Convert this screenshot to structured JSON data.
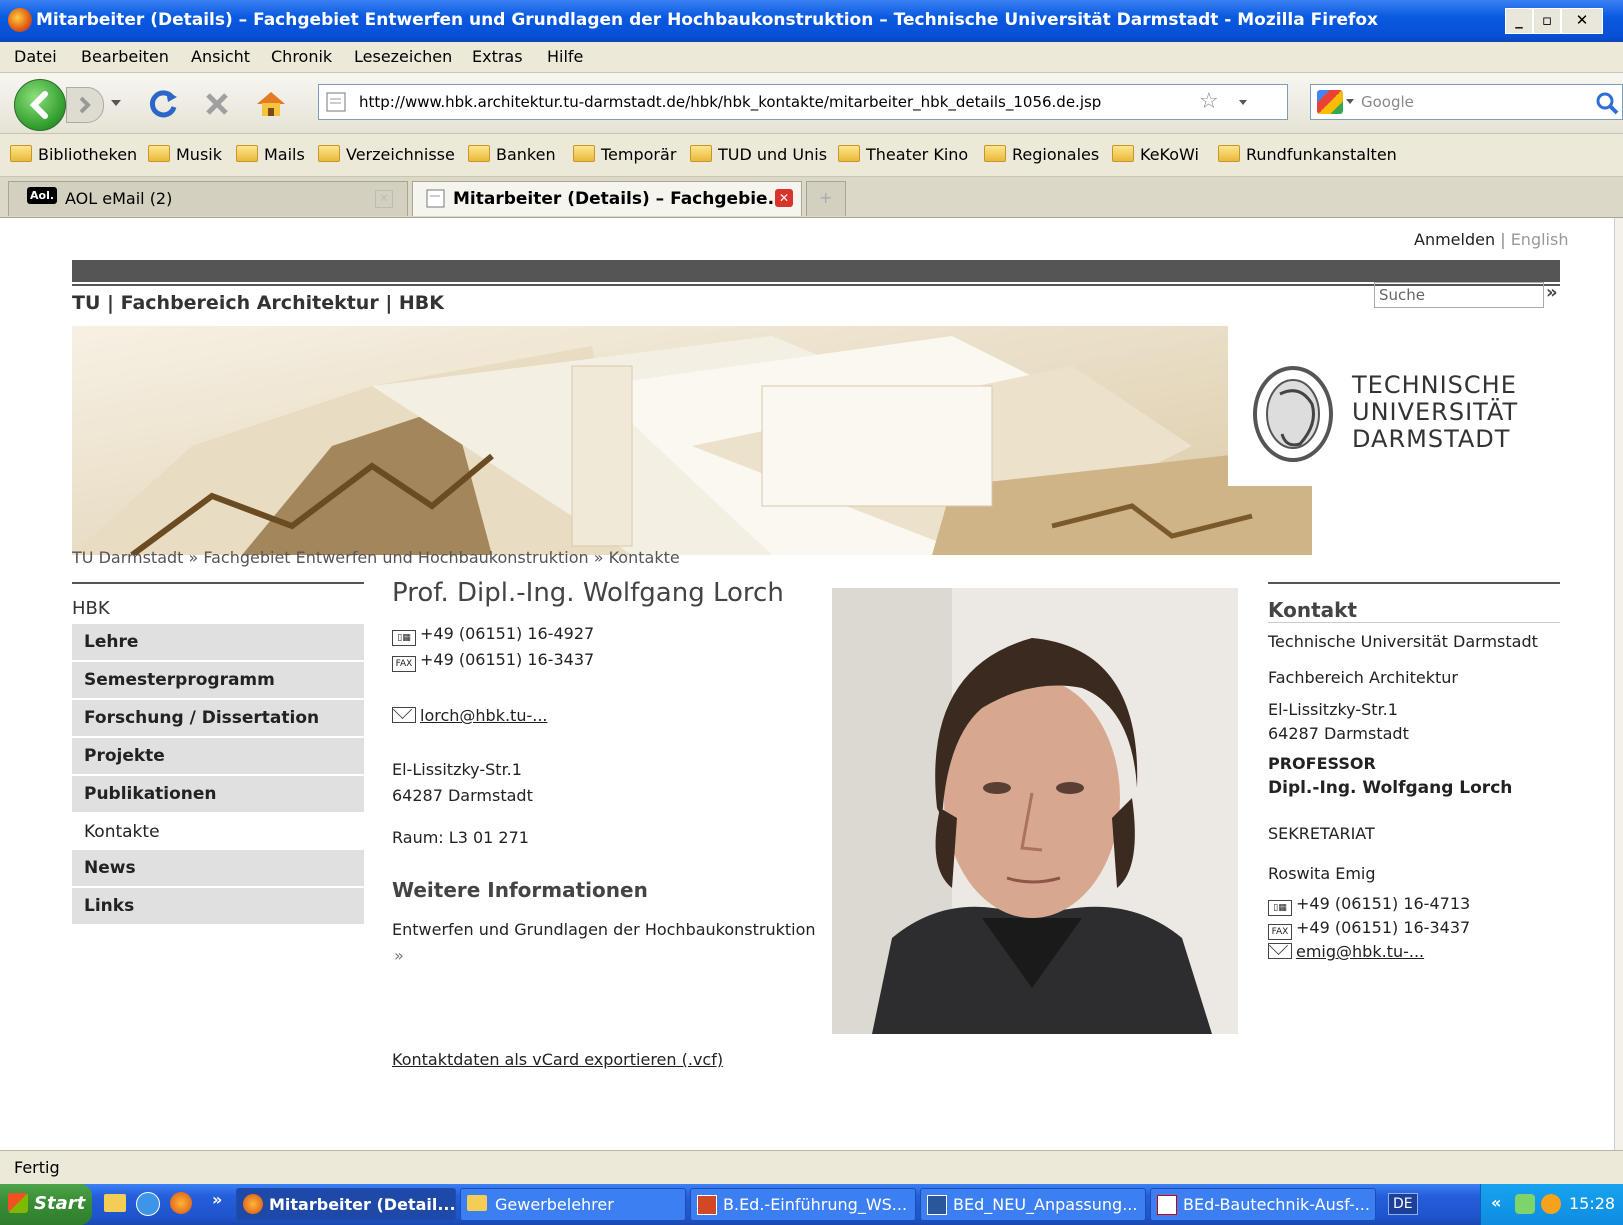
{
  "window": {
    "title": "Mitarbeiter (Details) – Fachgebiet Entwerfen und Grundlagen der Hochbaukonstruktion – Technische Universität Darmstadt - Mozilla Firefox"
  },
  "menu": [
    "Datei",
    "Bearbeiten",
    "Ansicht",
    "Chronik",
    "Lesezeichen",
    "Extras",
    "Hilfe"
  ],
  "nav": {
    "url": "http://www.hbk.architektur.tu-darmstadt.de/hbk/hbk_kontakte/mitarbeiter_hbk_details_1056.de.jsp",
    "search_placeholder": "Google"
  },
  "bookmarks": [
    "Bibliotheken",
    "Musik",
    "Mails",
    "Verzeichnisse",
    "Banken",
    "Temporär",
    "TUD und Unis",
    "Theater Kino",
    "Regionales",
    "KeKoWi",
    "Rundfunkanstalten"
  ],
  "tabs": [
    {
      "label": "AOL eMail (2)",
      "icon_label": "Aol."
    },
    {
      "label": "Mitarbeiter (Details) – Fachgebie..."
    }
  ],
  "page": {
    "login": "Anmelden",
    "separator": "|",
    "lang": "English",
    "site_path": {
      "tu": "TU",
      "sep": "|",
      "fb": "Fachbereich Architektur",
      "hbk": "HBK"
    },
    "search_placeholder": "Suche",
    "search_arrow": "»",
    "logo": {
      "line1": "TECHNISCHE",
      "line2": "UNIVERSITÄT",
      "line3": "DARMSTADT"
    },
    "breadcrumb": "TU Darmstadt » Fachgebiet Entwerfen und Hochbaukonstruktion » Kontakte",
    "sidebar": {
      "title": "HBK",
      "items": [
        "Lehre",
        "Semesterprogramm",
        "Forschung / Dissertation",
        "Projekte",
        "Publikationen",
        "Kontakte",
        "News",
        "Links"
      ]
    },
    "person": {
      "name": "Prof. Dipl.-Ing. Wolfgang Lorch",
      "phone": "+49 (06151) 16-4927",
      "fax": "+49 (06151) 16-3437",
      "fax_icon": "FAX",
      "email": "lorch@hbk.tu-...",
      "street": "El-Lissitzky-Str.1",
      "city": "64287 Darmstadt",
      "room": "Raum: L3 01 271",
      "more_heading": "Weitere Informationen",
      "more_text": "Entwerfen und Grundlagen der Hochbaukonstruktion",
      "more_arrow": "»",
      "vcard": "Kontaktdaten als vCard exportieren (.vcf)"
    },
    "kontakt": {
      "heading": "Kontakt",
      "uni": "Technische Universität Darmstadt",
      "fb": "Fachbereich Architektur",
      "street": "El-Lissitzky-Str.1",
      "city": "64287 Darmstadt",
      "role": "PROFESSOR",
      "prof_name": "Dipl.-Ing. Wolfgang Lorch",
      "sek_label": "SEKRETARIAT",
      "sek_name": "Roswita Emig",
      "sek_phone": "+49 (06151) 16-4713",
      "sek_fax": "+49 (06151) 16-3437",
      "sek_email": "emig@hbk.tu-..."
    }
  },
  "status": "Fertig",
  "taskbar": {
    "start": "Start",
    "chevron": "»",
    "tasks": [
      "Mitarbeiter (Detail...",
      "Gewerbelehrer",
      "B.Ed.-Einführung_WS...",
      "BEd_NEU_Anpassung...",
      "BEd-Bautechnik-Ausf-..."
    ],
    "lang": "DE",
    "tray_chevron": "«",
    "clock": "15:28"
  },
  "colors": {
    "xp_blue": "#0a5ae0",
    "page_bar": "#555555",
    "nav_grey": "#e0e0e0"
  }
}
